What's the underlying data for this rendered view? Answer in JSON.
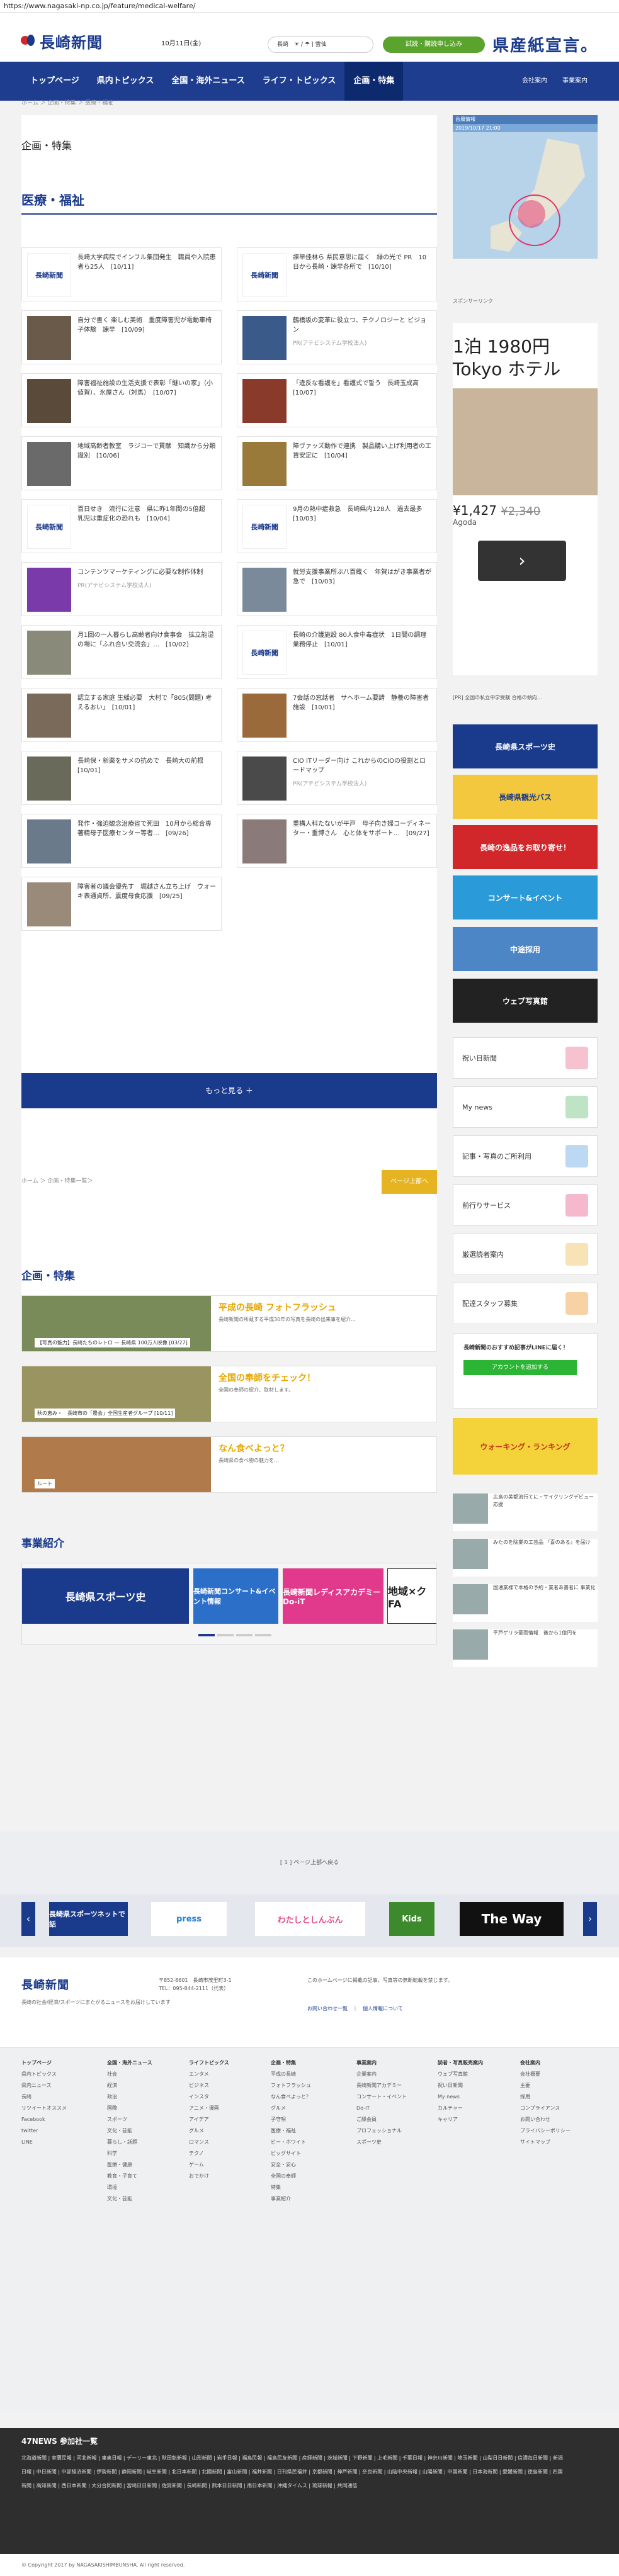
{
  "browser": {
    "url": "https://www.nagasaki-np.co.jp/feature/medical-welfare/"
  },
  "header": {
    "logo": "長崎新聞",
    "date": "10月11日(金)",
    "weather": "長崎　☀ / ☂ | 雲仙",
    "trial_button": "試読・購読申し込み",
    "paper_logo": "県産紙宣言。"
  },
  "nav": {
    "items": [
      "トップページ",
      "県内トピックス",
      "全国・海外ニュース",
      "ライフ・トピックス",
      "企画・特集"
    ],
    "active": 4,
    "right": [
      "会社案内",
      "事業案内"
    ]
  },
  "breadcrumb": "ホーム ＞ 企画・特集 ＞ 医療・福祉",
  "page": {
    "title": "企画・特集",
    "section": "医療・福祉"
  },
  "articles": [
    {
      "text": "長崎大学病院でインフル集団発生　職員や入院患者ら25人　[10/11]",
      "logo": true
    },
    {
      "text": "諫早佳林ら 県民意思に届く　緑の光で PR　10日から長崎・諫早各所で　[10/10]",
      "logo": true
    },
    {
      "text": "自分で書く 楽しむ美術　重度障害児が電動車椅子体験　諫早　[10/09]",
      "logo": false
    },
    {
      "text": "鶴橋坂の変革に役立つ、テクノロジーと ビジョン",
      "logo": false,
      "pr": "PR(アテビシステム学校法人)"
    },
    {
      "text": "障害福祉施設の生活支援で表彰「継いの家」（小値賀）、氷屋さん（対馬）　[10/07]",
      "logo": false
    },
    {
      "text": "「違反な看護を」看護式で誓う　長崎玉成高　[10/07]",
      "logo": false
    },
    {
      "text": "地域高齢者教室　ラジコーで貫献　知識から分類識別　[10/06]",
      "logo": false
    },
    {
      "text": "障ヴァッズ動作で連携　製品購い上げ利用者の工賃安定に　[10/04]",
      "logo": false
    },
    {
      "text": "百日せき　流行に注意　県に昨1年間の5倍超　乳児は重症化の恐れも　[10/04]",
      "logo": true
    },
    {
      "text": "9月の熱中症救急　長崎県内128人　過去最多　[10/03]",
      "logo": true
    },
    {
      "text": "コンテンツマーケティングに必要な制作体制",
      "logo": false,
      "pr": "PR(アテビシステム学校法人)"
    },
    {
      "text": "就労支援事業所ぶ八百蔵く　年賀はがき事業者が急で　[10/03]",
      "logo": false
    },
    {
      "text": "月1回の一人暮らし高齢者向け食事会　拡立能湿の場に「ふれ合い交流会」…　[10/02]",
      "logo": false
    },
    {
      "text": "長崎の介護施設 80人食中毒症状　1日間の調理業務停止　[10/01]",
      "logo": true
    },
    {
      "text": "認立する家庭 生緩必要　大村で「805(問題) 考えるおい」　[10/01]",
      "logo": false
    },
    {
      "text": "7会話の窓話者　サヘホーム要請　静養の障害者施設　[10/01]",
      "logo": false
    },
    {
      "text": "長崎保・新薬をサメの抗めで　長崎大の前根　[10/01]",
      "logo": false
    },
    {
      "text": "CIO ITリーダー向け これからのCIOの役割とロードマップ",
      "logo": false,
      "pr": "PR(アテビシステム学校法人)"
    },
    {
      "text": "発作・強迫観念治療省で死田　10月から総合専著精母子医療センター等者…　[09/26]",
      "logo": false
    },
    {
      "text": "重構人科たないが平戸　母子向き婦コーディネーター・重博さん　心と体をサポート…　[09/27]",
      "logo": false
    },
    {
      "text": "障害者の議会優先す　堀越さん立ち上げ　ウォーキ表通貞所、震度母食応援　[09/25]",
      "logo": false
    }
  ],
  "more_button": "もっと見る ＋",
  "bottom_breadcrumb": "ホーム ＞ 企画・特集一覧＞",
  "to_top": "ページ上部へ",
  "features": {
    "title": "企画・特集",
    "items": [
      {
        "img_label": "【写真の魅力】長崎たちのレトロ — 長崎県 100万人映像 [03/27]",
        "title": "平成の長崎 フォトフラッシュ",
        "desc": "長崎新聞の所蔵する平成30年の写真を長崎の出来事を紹介…"
      },
      {
        "img_label": "秋の恵み・　長崎市の「農会」全国生産者グループ [10/11]",
        "title": "全国の奉師をチェック！",
        "desc": "全国の奉師の紹介、取材します。"
      },
      {
        "img_label": "ルート",
        "title": "なん食べよっと？",
        "desc": "長崎県の食べ物の魅力を…"
      }
    ]
  },
  "business": {
    "title": "事業紹介",
    "items": [
      "長崎県スポーツ史",
      "長崎新聞コンサート&イベント情報",
      "長崎新聞レディスアカデミーDo-iT",
      "地域×ク FA"
    ]
  },
  "sidebar": {
    "map_label": "台風情報",
    "map_time": "2019/10/17 21:00",
    "sponsor_link": "スポンサーリンク",
    "ad": {
      "title": "1泊 1980円 Tokyo ホテル",
      "price_new": "¥1,427",
      "price_old": "¥2,340",
      "brand": "Agoda"
    },
    "ad_caption": "[PR] 全国の私立中学受験 合格の傾向…",
    "banners": [
      "長崎県スポーツ史",
      "長崎県観光バス",
      "長崎の逸品をお取り寄せ！",
      "コンサート&イベント",
      "中途採用",
      "ウェブ写真館"
    ],
    "menu": [
      "祝い日新聞",
      "My news",
      "記事・写真のご所利用",
      "前行りサービス",
      "厳選読者案内",
      "配達スタッフ募集"
    ],
    "line_title": "長崎新聞のおすすめ記事がLINEに届く！",
    "line_button": "アカウントを追加する",
    "cheer": "ウォーキング・ランキング",
    "news": [
      "広島の美都流行てに・サイクリングデビュー応援",
      "みたのを除業の工芸品 『喜のある』を届け",
      "国通業様で本格の予約・業者あ書者に 事業化",
      "平戸ゲリラ豪雨情報　後から1億円を"
    ]
  },
  "pager": "[ 1 ] ページ上部へ戻る",
  "sponsors": [
    "長崎県スポーツネットで話",
    "press",
    "わたしとしんぶん",
    "Kids",
    "The Way"
  ],
  "footer": {
    "logo": "長崎新聞",
    "address": "〒852-8601　長崎市茂里町3-1\nTEL：095-844-2111（代表）",
    "tagline": "長崎の社会/経済/スポーツにまたがるニュースをお届けしています",
    "right": "このホームページに掲載の記事、写真等の無断転載を禁じます。",
    "links": "お問い合わせ一覧　｜　個人情報について"
  },
  "sitemap": [
    {
      "title": "トップページ",
      "items": [
        "県内トピックス",
        "県内ニュース",
        "長崎",
        "リツイートオススメ",
        "Facebook",
        "twitter",
        "LINE"
      ]
    },
    {
      "title": "全国・海外ニュース",
      "items": [
        "社会",
        "経済",
        "政治",
        "国際",
        "スポーツ",
        "文化・芸能",
        "暮らし・話題",
        "科学",
        "医療・健康",
        "教育・子育て",
        "環境",
        "文化・芸能"
      ]
    },
    {
      "title": "ライフトピックス",
      "items": [
        "エンタメ",
        "ビジネス",
        "インスタ",
        "アニメ・漫画",
        "アイデア",
        "グルメ",
        "ロマンス",
        "テクノ",
        "ゲーム",
        "おでかけ"
      ]
    },
    {
      "title": "企画・特集",
      "items": [
        "平成の長崎",
        "フォトフラッシュ",
        "なん食べよっと？",
        "グルメ",
        "子守唄",
        "医療・福祉",
        "ビー・ホワイト",
        "ビッグサイト",
        "安全・安心",
        "全国の奉師",
        "特集",
        "事業紹介"
      ]
    },
    {
      "title": "事業案内",
      "items": [
        "企業案内",
        "長崎新聞アカデミー",
        "コンサート・イベント",
        "Do-iT",
        "ご縁会員",
        "プロフェッショナル",
        "スポーツ史"
      ]
    },
    {
      "title": "読者・写真販売案内",
      "items": [
        "ウェブ写真館",
        "祝い日新聞",
        "My news",
        "カルチャー",
        "キャリア"
      ]
    },
    {
      "title": "会社案内",
      "items": [
        "会社概要",
        "主要",
        "採用",
        "コンプライアンス",
        "お問い合わせ",
        "プライバシーポリシー",
        "サイトマップ"
      ]
    }
  ],
  "n47": {
    "title": "47NEWS 参加社一覧",
    "links": "北海道新聞 | 室蘭民報 | 河北新報 | 東奥日報 | デーリー東北 | 秋田魁新報 | 山形新聞 | 岩手日報 | 福島民報 | 福島民友新聞 | 産経新聞 | 茨城新聞 | 下野新聞 | 上毛新聞 | 千葉日報 | 神奈川新聞 | 埼玉新聞 | 山梨日日新聞 | 信濃毎日新聞 | 新潟日報 | 中日新聞 | 中部経済新聞 | 伊勢新聞 | 静岡新聞 | 岐阜新聞 | 北日本新聞 | 北國新聞 | 富山新聞 | 福井新聞 | 日刊県民福井 | 京都新聞 | 神戸新聞 | 奈良新聞 | 山陰中央新報 | 山陽新聞 | 中国新聞 | 日本海新聞 | 愛媛新聞 | 徳島新聞 | 四国新聞 | 高知新聞 | 西日本新聞 | 大分合同新聞 | 宮崎日日新聞 | 佐賀新聞 | 長崎新聞 | 熊本日日新聞 | 南日本新聞 | 沖縄タイムス | 琉球新報 | 共同通信"
  },
  "copyright": "© Copyright 2017 by NAGASAKISHIMBUNSHA. All right reserved."
}
